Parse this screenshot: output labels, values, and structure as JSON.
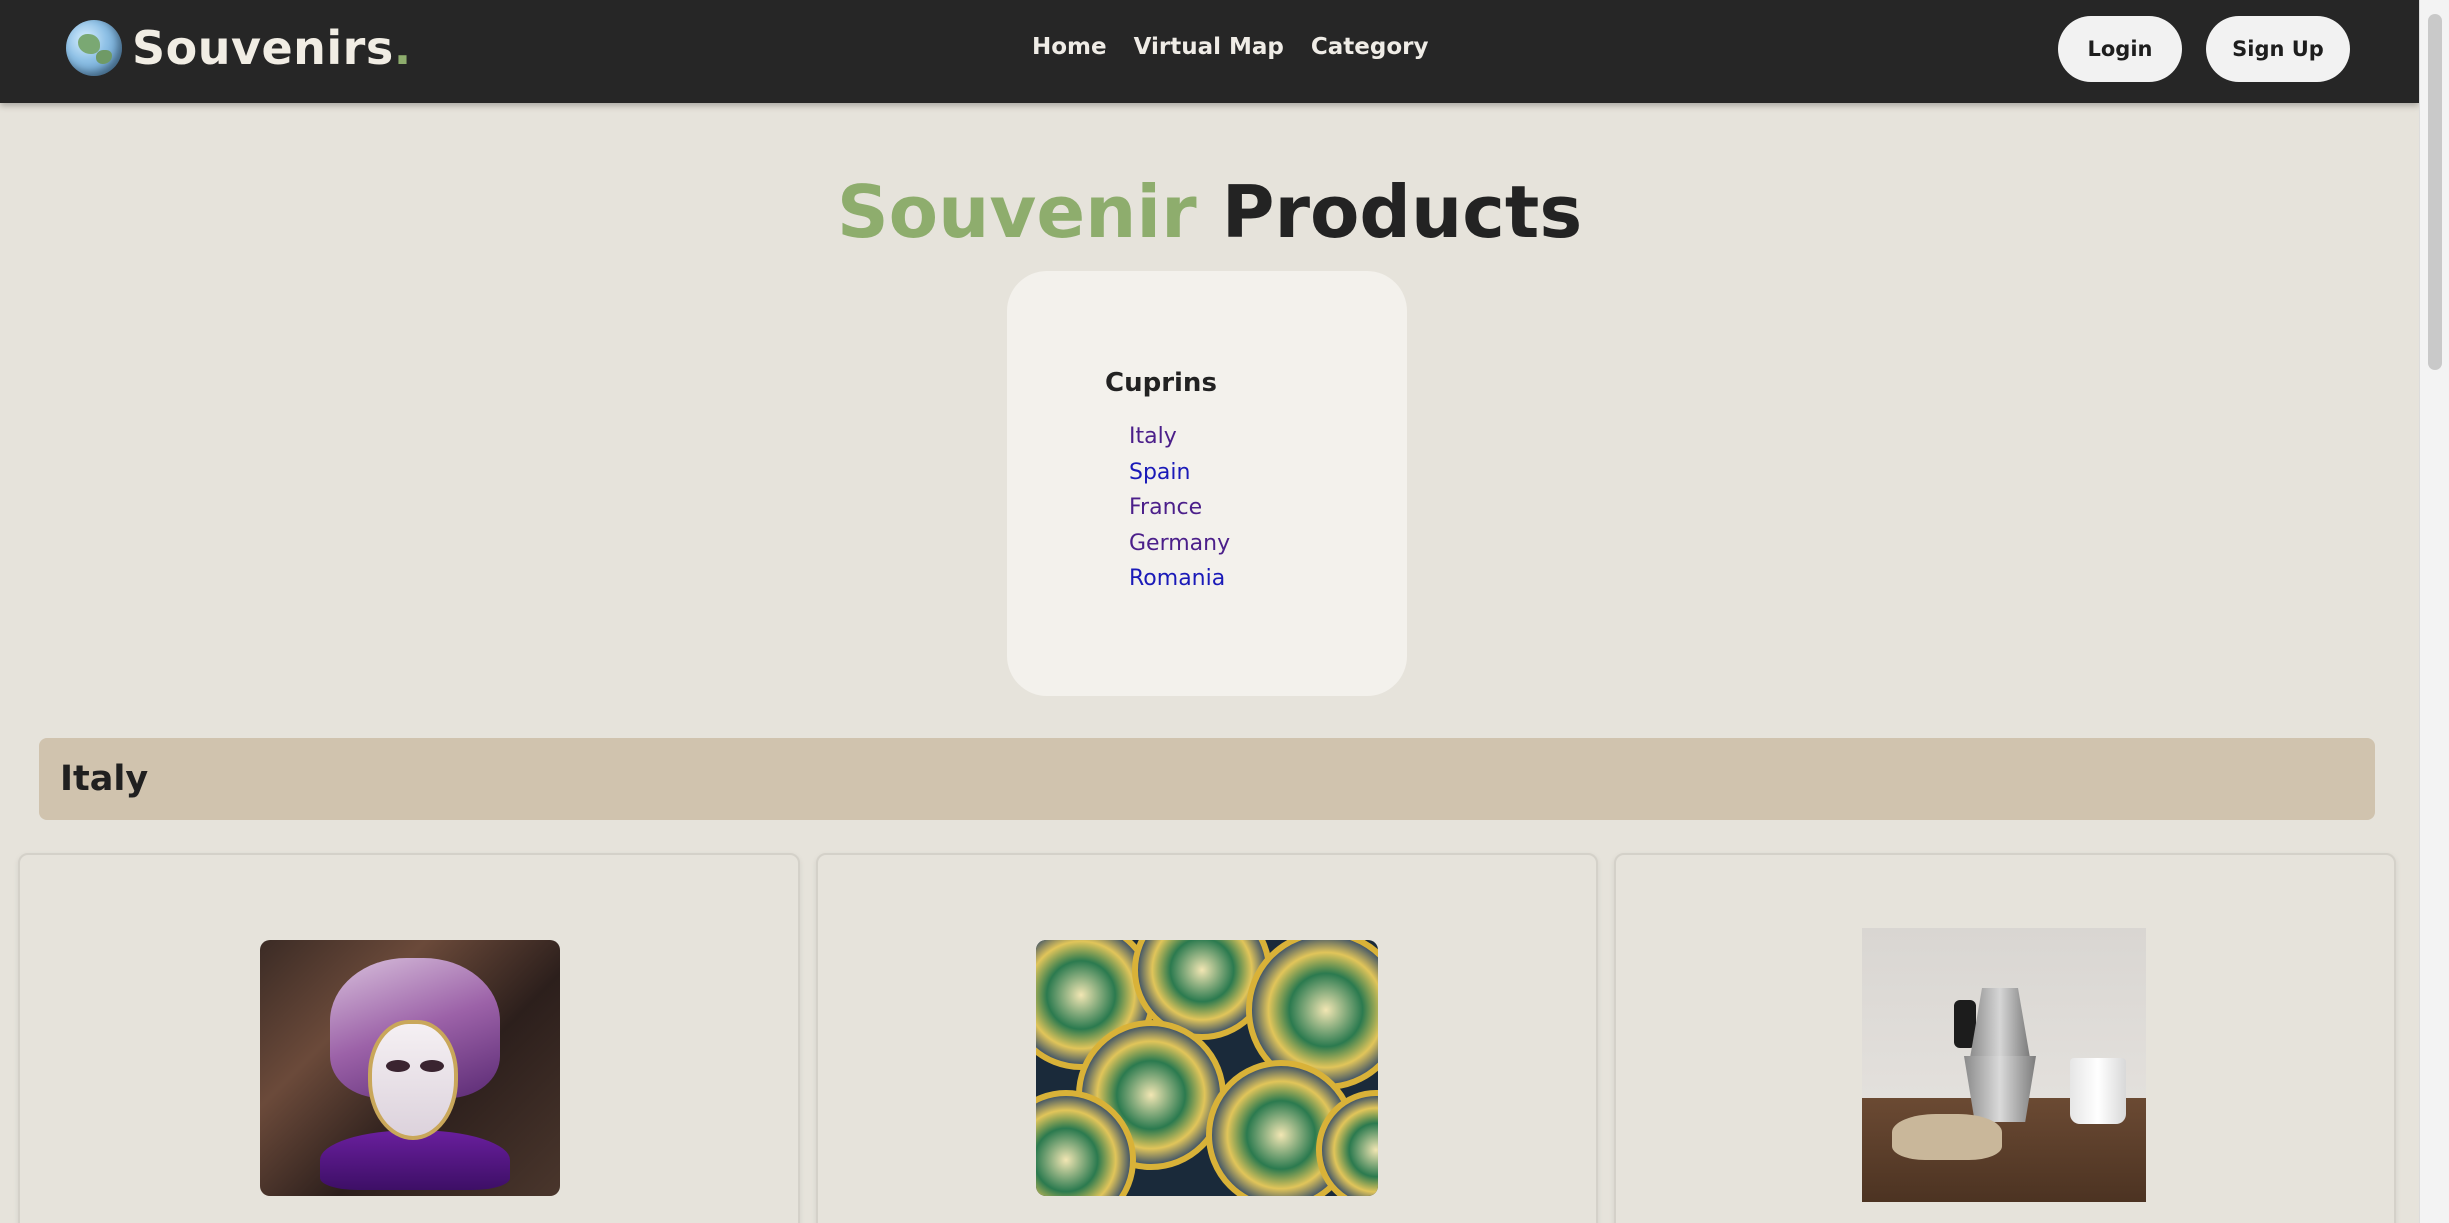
{
  "header": {
    "brand": "Souvenirs",
    "brand_dot": ".",
    "nav": [
      "Home",
      "Virtual Map",
      "Category"
    ],
    "login_label": "Login",
    "signup_label": "Sign Up"
  },
  "title": {
    "accent": "Souvenir",
    "rest": "Products"
  },
  "panel": {
    "heading": "Cuprins",
    "countries": [
      "Italy",
      "Spain",
      "France",
      "Germany",
      "Romania"
    ]
  },
  "section": {
    "title": "Italy"
  },
  "colors": {
    "navbar": "#262626",
    "accent_green": "#8ead6d",
    "background": "#e6e3db",
    "section_bar": "#d0c3ae",
    "visited_link": "#4b1f8a",
    "link": "#1a1ab8"
  },
  "icons": {
    "brand_logo": "globe-icon"
  }
}
